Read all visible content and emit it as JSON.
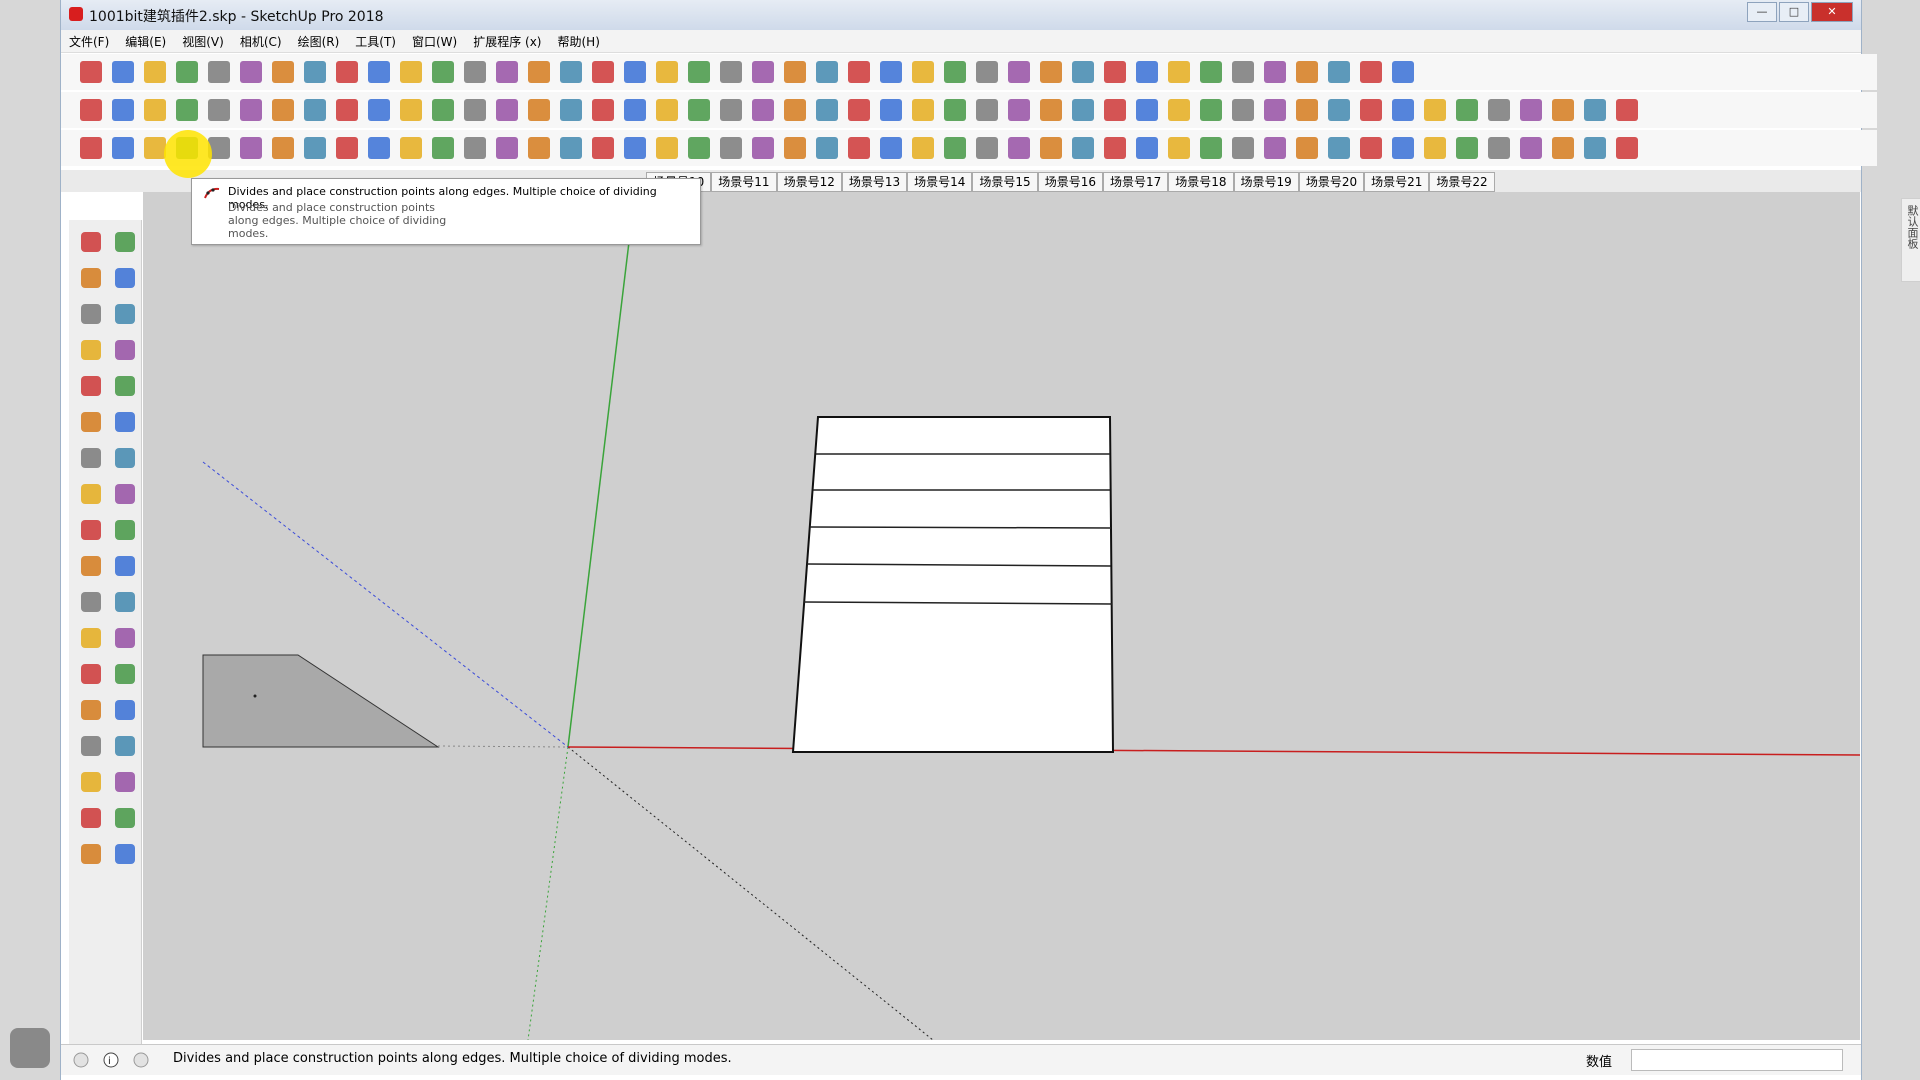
{
  "window": {
    "title": "1001bit建筑插件2.skp - SketchUp Pro 2018"
  },
  "menu": [
    "文件(F)",
    "编辑(E)",
    "视图(V)",
    "相机(C)",
    "绘图(R)",
    "工具(T)",
    "窗口(W)",
    "扩展程序 (x)",
    "帮助(H)"
  ],
  "scene_tabs": [
    "场景号10",
    "场景号11",
    "场景号12",
    "场景号13",
    "场景号14",
    "场景号15",
    "场景号16",
    "场景号17",
    "场景号18",
    "场景号19",
    "场景号20",
    "场景号21",
    "场景号22"
  ],
  "tooltip": {
    "title": "Divides and place construction points along edges. Multiple choice of dividing modes.",
    "body": "Divides and place construction points along edges. Multiple choice of dividing modes."
  },
  "status": {
    "message": "Divides and place construction points along edges. Multiple choice of dividing modes.",
    "value_label": "数值",
    "value": ""
  },
  "right_panel_label": "默认面板",
  "colors": {
    "accent_red": "#cc1f1f",
    "highlight_yellow": "#ffe400",
    "axis_green": "#3aa43a",
    "axis_red": "#c81e1e",
    "axis_blue": "#3b4bd9"
  },
  "toolbar_icons": {
    "row1": [
      "new-file-icon",
      "open-file-icon",
      "save-icon",
      "cut-icon",
      "copy-icon",
      "paste-icon",
      "erase-icon",
      "undo-icon",
      "redo-icon",
      "print-icon",
      "model-info-icon",
      "select-icon",
      "paint-bucket-icon",
      "push-pull-icon",
      "offset-icon",
      "section-icon",
      "layer-icon",
      "tape-icon",
      "dimension-icon",
      "protractor-icon",
      "text-icon",
      "axes-icon",
      "3d-text-icon",
      "orbit-icon",
      "pan-icon",
      "zoom-icon",
      "zoom-window-icon",
      "zoom-extents-icon",
      "prev-view-icon",
      "next-view-icon",
      "iso-view-icon",
      "top-view-icon",
      "front-view-icon",
      "right-view-icon",
      "back-view-icon",
      "left-view-icon",
      "xray-icon",
      "wireframe-icon",
      "hidden-line-icon",
      "shaded-icon",
      "shaded-textures-icon",
      "monochrome-icon"
    ],
    "row2": [
      "1001bit-a",
      "1001bit-b",
      "1001bit-c",
      "1001bit-d",
      "1001bit-e",
      "1001bit-f",
      "1001bit-g",
      "1001bit-h",
      "1001bit-i",
      "1001bit-j",
      "1001bit-k",
      "1001bit-l",
      "1001bit-m",
      "1001bit-n",
      "1001bit-o",
      "1001bit-p",
      "1001bit-q",
      "1001bit-r",
      "1001bit-s",
      "1001bit-t",
      "1001bit-u",
      "1001bit-v",
      "1001bit-w",
      "1001bit-x",
      "1001bit-y",
      "1001bit-z",
      "1001bit-aa",
      "1001bit-ab",
      "1001bit-ac",
      "1001bit-ad",
      "1001bit-ae",
      "1001bit-af",
      "1001bit-ag",
      "1001bit-ah",
      "1001bit-ai",
      "1001bit-aj",
      "1001bit-ak",
      "1001bit-al",
      "1001bit-am",
      "1001bit-an",
      "1001bit-ao",
      "1001bit-ap",
      "1001bit-aq",
      "1001bit-ar",
      "1001bit-as",
      "1001bit-at",
      "1001bit-au",
      "1001bit-av",
      "1001bit-aw"
    ],
    "row3": [
      "divide-edge-icon",
      "construction-points-icon",
      "fillet-icon",
      "chamfer-icon",
      "offset-edge-icon",
      "extend-edge-icon",
      "trim-edge-icon",
      "circle-point-icon",
      "arc-icon",
      "curve-icon",
      "stair-icon",
      "railing-icon",
      "wall-icon",
      "door-icon",
      "window-icon",
      "roof-icon",
      "column-icon",
      "beam-icon",
      "slab-icon",
      "grid-icon",
      "landscape-icon",
      "terrain-icon",
      "pattern-icon",
      "hatch-icon",
      "array-icon",
      "copy-along-icon",
      "rotate-array-icon",
      "mirror-icon",
      "scale-icon",
      "align-icon",
      "distribute-icon",
      "group-icon",
      "component-icon",
      "explode-icon",
      "layer-manager-icon",
      "scene-manager-icon",
      "style-icon",
      "render-icon",
      "export-icon",
      "import-icon",
      "settings-icon",
      "help-icon",
      "vertex-icon",
      "spline-icon",
      "bezier-icon",
      "nurbs-icon",
      "loft-icon",
      "sweep-icon",
      "extrude-icon"
    ]
  },
  "left_tools": [
    "select-icon",
    "component-icon",
    "paint-bucket-icon",
    "eraser-icon",
    "line-icon",
    "freehand-icon",
    "rectangle-icon",
    "rotated-rect-icon",
    "circle-icon",
    "polygon-icon",
    "arc-icon",
    "two-point-arc-icon",
    "three-point-arc-icon",
    "pie-icon",
    "move-icon",
    "push-pull-icon",
    "rotate-icon",
    "follow-me-icon",
    "scale-icon",
    "offset-icon",
    "tape-icon",
    "dimension-icon",
    "protractor-icon",
    "text-icon",
    "axes-icon",
    "3d-text-icon",
    "orbit-icon",
    "pan-icon",
    "zoom-icon",
    "zoom-window-icon",
    "zoom-extents-icon",
    "zoom-previous-icon",
    "position-camera-icon",
    "look-around-icon",
    "walk-icon",
    "section-plane-icon"
  ]
}
